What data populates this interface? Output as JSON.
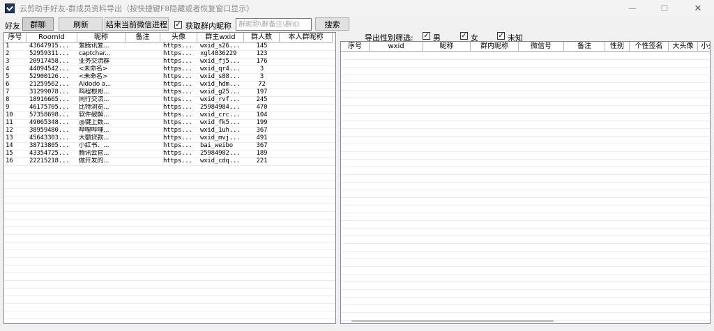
{
  "window": {
    "title": "云剪助手好友-群成员资料导出（按快捷键F8隐藏或者恢复窗口显示）",
    "min_icon": "—",
    "max_icon": "☐",
    "close_icon": "✕"
  },
  "toolbar": {
    "friends_label": "好友",
    "group_chat_button": "群聊",
    "refresh_button": "刷新",
    "end_process_button": "结束当前微信进程",
    "get_nickname_check": "✓",
    "get_nickname_label": "获取群内昵称",
    "search_placeholder": "群昵称\\群备注\\群ID",
    "search_button": "搜索"
  },
  "filter": {
    "label": "导出性别筛选:",
    "male_check": "✓",
    "male_label": "男",
    "female_check": "✓",
    "female_label": "女",
    "unknown_check": "✓",
    "unknown_label": "未知"
  },
  "group_table": {
    "columns": [
      "序号",
      "RoomId",
      "昵称",
      "备注",
      "头像",
      "群主wxid",
      "群人数",
      "本人群昵称"
    ],
    "rows": [
      [
        "1",
        "43647915...",
        "爱腾讯爱...",
        "",
        "https...",
        "wxid_s26...",
        "145",
        ""
      ],
      [
        "2",
        "52959311...",
        "captchar...",
        "",
        "https...",
        "xgl4836229",
        "123",
        ""
      ],
      [
        "3",
        "20917458...",
        "业务交流群",
        "",
        "https...",
        "wxid_fj5...",
        "176",
        ""
      ],
      [
        "4",
        "44094542...",
        "<未命名>",
        "",
        "https...",
        "wxid_qr4...",
        "3",
        ""
      ],
      [
        "5",
        "52900126...",
        "<未命名>",
        "",
        "https...",
        "wxid_s88...",
        "3",
        ""
      ],
      [
        "6",
        "21259562...",
        "AIdodo a...",
        "",
        "https...",
        "wxid_hdm...",
        "72",
        ""
      ],
      [
        "7",
        "31299078...",
        "鸣程根哥...",
        "",
        "https...",
        "wxid_g25...",
        "197",
        ""
      ],
      [
        "8",
        "18916665...",
        "同行交流...",
        "",
        "https...",
        "wxid_rvf...",
        "245",
        ""
      ],
      [
        "9",
        "46175705...",
        "比特浏览...",
        "",
        "https...",
        "25984984...",
        "470",
        ""
      ],
      [
        "10",
        "57358698...",
        "软件破解...",
        "",
        "https...",
        "wxid_crc...",
        "104",
        ""
      ],
      [
        "11",
        "49065348...",
        "@键上数...",
        "",
        "https...",
        "wxid_fk5...",
        "199",
        ""
      ],
      [
        "12",
        "38959480...",
        "哔哩哔哩...",
        "",
        "https...",
        "wxid_1uh...",
        "367",
        ""
      ],
      [
        "13",
        "45643303...",
        "大额贷款...",
        "",
        "https...",
        "wxid_mvj...",
        "491",
        ""
      ],
      [
        "14",
        "38713805...",
        "小红书、...",
        "",
        "https...",
        "bai_weibo",
        "367",
        ""
      ],
      [
        "15",
        "43354725...",
        "腾讯云官...",
        "",
        "https...",
        "25984982...",
        "189",
        ""
      ],
      [
        "16",
        "22215218...",
        "做开发的...",
        "",
        "https...",
        "wxid_cdq...",
        "221",
        ""
      ]
    ]
  },
  "member_table": {
    "columns": [
      "序号",
      "wxid",
      "昵称",
      "群内昵称",
      "微信号",
      "备注",
      "性别",
      "个性签名",
      "大头像",
      "小头像"
    ]
  }
}
